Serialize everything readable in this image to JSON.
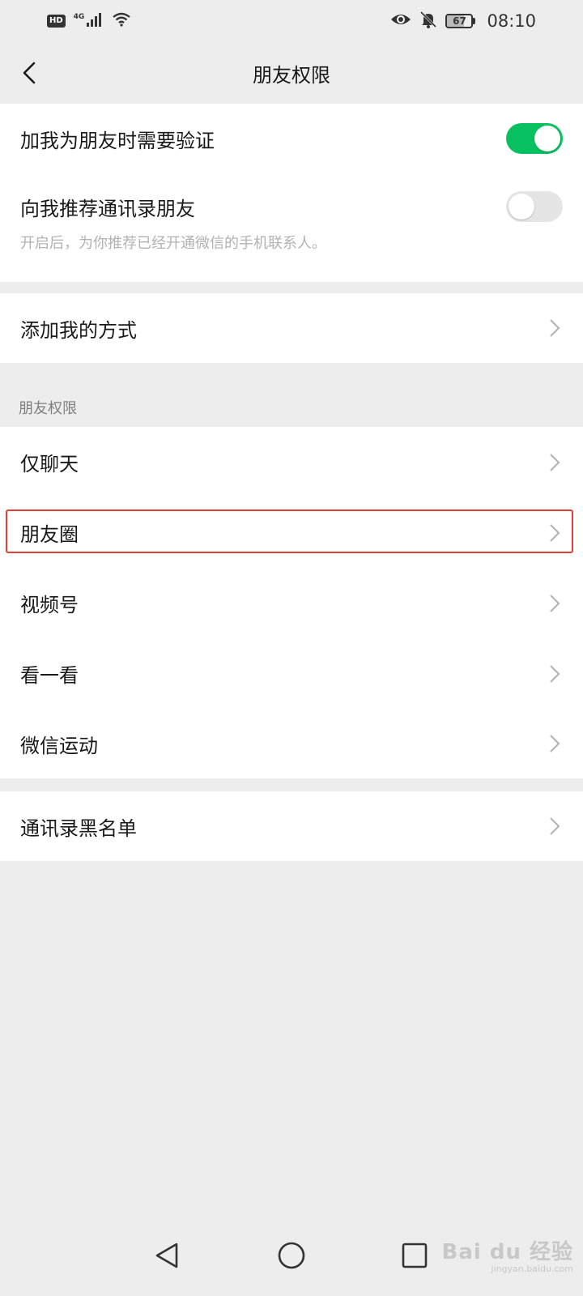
{
  "status_bar": {
    "hd": "HD",
    "network": "4G",
    "battery": {
      "level": "67",
      "fraction": 0.67
    },
    "time": "08:10",
    "icons": [
      "signal-icon",
      "wifi-icon",
      "eye-icon",
      "bell-off-icon",
      "battery-icon"
    ]
  },
  "nav": {
    "title": "朋友权限",
    "back_icon": "chevron-left-icon"
  },
  "group1": {
    "verify": {
      "label": "加我为朋友时需要验证",
      "on": true
    },
    "recommend": {
      "label": "向我推荐通讯录朋友",
      "desc": "开启后，为你推荐已经开通微信的手机联系人。",
      "on": false
    }
  },
  "group2": {
    "add_methods": {
      "label": "添加我的方式"
    }
  },
  "section_title": "朋友权限",
  "group3": {
    "items": [
      {
        "label": "仅聊天"
      },
      {
        "label": "朋友圈"
      },
      {
        "label": "视频号"
      },
      {
        "label": "看一看"
      },
      {
        "label": "微信运动"
      }
    ]
  },
  "group4": {
    "blacklist": {
      "label": "通讯录黑名单"
    }
  },
  "bottom_nav": {
    "icons": [
      "back-triangle-icon",
      "home-circle-icon",
      "recents-square-icon"
    ]
  },
  "watermark": {
    "main": "Bai du 经验",
    "sub": "jingyan.baidu.com"
  },
  "colors": {
    "accent": "#07c160",
    "highlight": "#e0403a",
    "background": "#ededed"
  }
}
